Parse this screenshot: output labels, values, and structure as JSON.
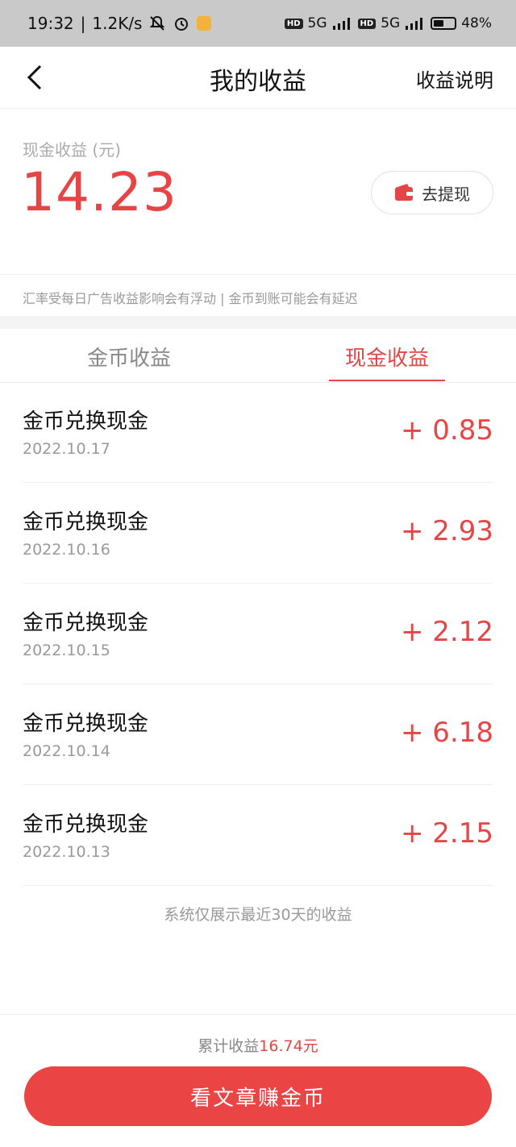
{
  "status_bar": {
    "time": "19:32",
    "speed": "1.2K/s",
    "signal1": "5G",
    "signal2": "5G",
    "battery": "48%",
    "battery_level": 0.48,
    "icons": [
      "mute-bell-icon",
      "alarm-icon",
      "app-notification-icon",
      "hd-icon",
      "signal-icon",
      "battery-icon"
    ]
  },
  "header": {
    "title": "我的收益",
    "help_label": "收益说明"
  },
  "summary": {
    "cash_label": "现金收益 (元)",
    "cash_amount": "14.23",
    "withdraw_label": "去提现",
    "note": "汇率受每日广告收益影响会有浮动 | 金币到账可能会有延迟"
  },
  "tabs": [
    {
      "label": "金币收益",
      "active": false
    },
    {
      "label": "现金收益",
      "active": true
    }
  ],
  "records": [
    {
      "title": "金币兑换现金",
      "date": "2022.10.17",
      "amount": "+ 0.85"
    },
    {
      "title": "金币兑换现金",
      "date": "2022.10.16",
      "amount": "+ 2.93"
    },
    {
      "title": "金币兑换现金",
      "date": "2022.10.15",
      "amount": "+ 2.12"
    },
    {
      "title": "金币兑换现金",
      "date": "2022.10.14",
      "amount": "+ 6.18"
    },
    {
      "title": "金币兑换现金",
      "date": "2022.10.13",
      "amount": "+ 2.15"
    }
  ],
  "list_footnote": "系统仅展示最近30天的收益",
  "bottom": {
    "total_label": "累计收益",
    "total_value": "16.74元",
    "cta_label": "看文章赚金币"
  },
  "colors": {
    "accent": "#e64545",
    "cta": "#ea4444",
    "status_bar": "#c9c9c9"
  }
}
